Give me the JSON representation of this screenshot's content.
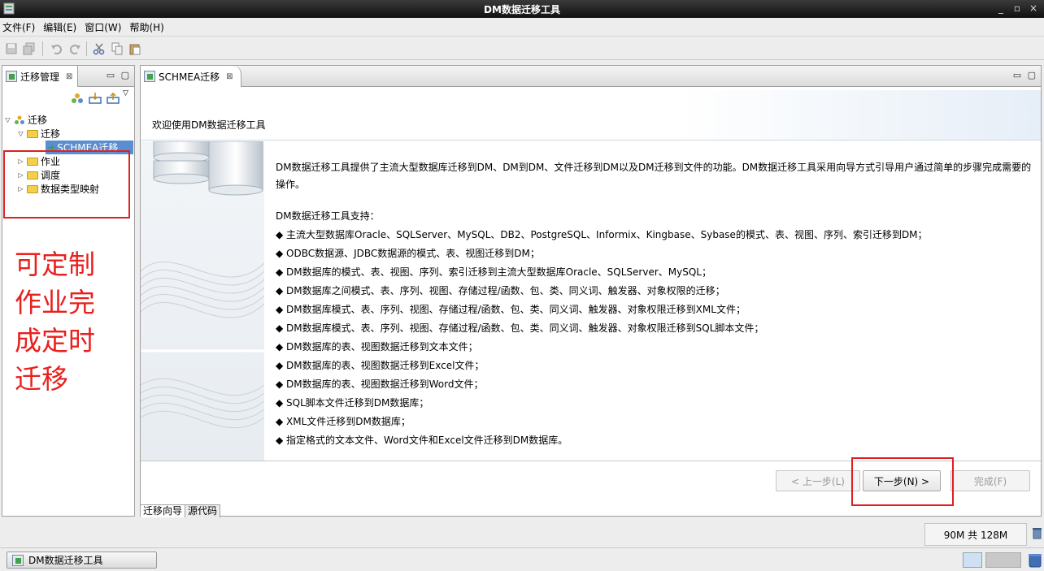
{
  "window": {
    "title": "DM数据迁移工具",
    "controls": [
      "_",
      "▫",
      "×"
    ]
  },
  "menubar": {
    "items": [
      "文件(F)",
      "编辑(E)",
      "窗口(W)",
      "帮助(H)"
    ]
  },
  "left_panel": {
    "tab_label": "迁移管理",
    "tree": [
      {
        "label": "迁移",
        "level": 0,
        "expanded": true,
        "icon": "people-icon"
      },
      {
        "label": "迁移",
        "level": 1,
        "expanded": true,
        "icon": "folder-icon"
      },
      {
        "label": "SCHMEA迁移",
        "level": 2,
        "selected": true,
        "icon": "arrow-icon"
      },
      {
        "label": "作业",
        "level": 1,
        "expanded": false,
        "icon": "folder-icon"
      },
      {
        "label": "调度",
        "level": 1,
        "expanded": false,
        "icon": "folder-icon"
      },
      {
        "label": "数据类型映射",
        "level": 1,
        "expanded": false,
        "icon": "folder-icon"
      }
    ]
  },
  "annotation": {
    "text_lines": [
      "可定制",
      "作业完",
      "成定时",
      "迁移"
    ]
  },
  "main_panel": {
    "tab_label": "SCHMEA迁移",
    "header_title": "欢迎使用DM数据迁移工具",
    "intro": "DM数据迁移工具提供了主流大型数据库迁移到DM、DM到DM、文件迁移到DM以及DM迁移到文件的功能。DM数据迁移工具采用向导方式引导用户通过简单的步骤完成需要的操作。",
    "support_title": "DM数据迁移工具支持：",
    "features": [
      "◆ 主流大型数据库Oracle、SQLServer、MySQL、DB2、PostgreSQL、Informix、Kingbase、Sybase的模式、表、视图、序列、索引迁移到DM；",
      "◆ ODBC数据源、JDBC数据源的模式、表、视图迁移到DM；",
      "◆ DM数据库的模式、表、视图、序列、索引迁移到主流大型数据库Oracle、SQLServer、MySQL；",
      "◆ DM数据库之间模式、表、序列、视图、存储过程/函数、包、类、同义词、触发器、对象权限的迁移；",
      "◆ DM数据库模式、表、序列、视图、存储过程/函数、包、类、同义词、触发器、对象权限迁移到XML文件；",
      "◆ DM数据库模式、表、序列、视图、存储过程/函数、包、类、同义词、触发器、对象权限迁移到SQL脚本文件；",
      "◆ DM数据库的表、视图数据迁移到文本文件；",
      "◆ DM数据库的表、视图数据迁移到Excel文件；",
      "◆ DM数据库的表、视图数据迁移到Word文件；",
      "◆ SQL脚本文件迁移到DM数据库；",
      "◆ XML文件迁移到DM数据库；",
      "◆ 指定格式的文本文件、Word文件和Excel文件迁移到DM数据库。"
    ],
    "buttons": {
      "prev": "< 上一步(L)",
      "next": "下一步(N) >",
      "finish": "完成(F)"
    },
    "bottom_tabs": [
      "迁移向导",
      "源代码"
    ]
  },
  "status": {
    "memory": "90M 共 128M"
  },
  "taskbar": {
    "app_label": "DM数据迁移工具"
  }
}
